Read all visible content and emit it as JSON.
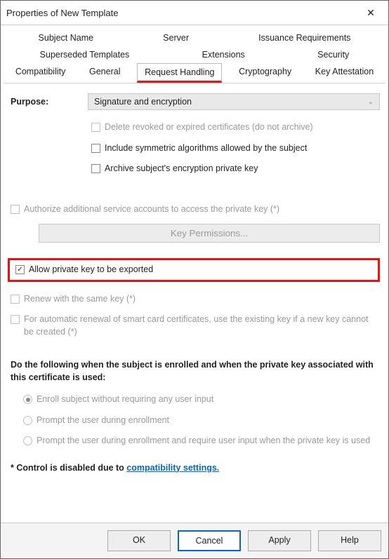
{
  "window": {
    "title": "Properties of New Template"
  },
  "tabs": {
    "row1": [
      "Subject Name",
      "Server",
      "Issuance Requirements"
    ],
    "row2": [
      "Superseded Templates",
      "Extensions",
      "Security"
    ],
    "row3": [
      "Compatibility",
      "General",
      "Request Handling",
      "Cryptography",
      "Key Attestation"
    ],
    "active": "Request Handling"
  },
  "form": {
    "purpose_label": "Purpose:",
    "purpose_value": "Signature and encryption",
    "delete_revoked": "Delete revoked or expired certificates (do not archive)",
    "include_symmetric": "Include symmetric algorithms allowed by the subject",
    "archive_key": "Archive subject's encryption private key",
    "authorize": "Authorize additional service accounts to access the private key (*)",
    "key_permissions_btn": "Key Permissions...",
    "allow_export": "Allow private key to be exported",
    "renew_same": "Renew with the same key (*)",
    "auto_renewal": "For automatic renewal of smart card certificates, use the existing key if a new key cannot be created (*)",
    "do_following": "Do the following when the subject is enrolled and when the private key associated with this certificate is used:",
    "radio_enroll": "Enroll subject without requiring any user input",
    "radio_prompt": "Prompt the user during enrollment",
    "radio_prompt_require": "Prompt the user during enrollment and require user input when the private key is used",
    "disabled_note_prefix": "* Control is disabled due to ",
    "disabled_note_link": "compatibility settings."
  },
  "buttons": {
    "ok": "OK",
    "cancel": "Cancel",
    "apply": "Apply",
    "help": "Help"
  }
}
